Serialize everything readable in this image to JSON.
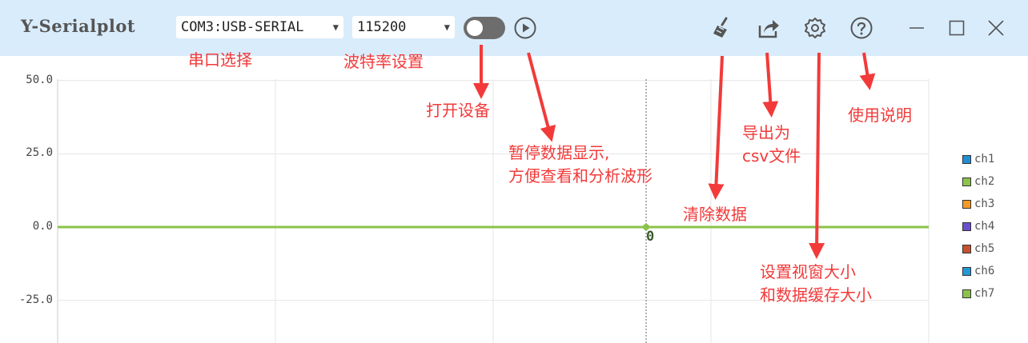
{
  "app": {
    "title": "Y-Serialplot"
  },
  "toolbar": {
    "port": "COM3:USB-SERIAL",
    "baud": "115200",
    "toggle_on": false
  },
  "annotations": {
    "port_select": "串口选择",
    "baud_set": "波特率设置",
    "open_device": "打开设备",
    "pause_line1": "暂停数据显示,",
    "pause_line2": "方便查看和分析波形",
    "clear": "清除数据",
    "export_line1": "导出为",
    "export_line2": "csv文件",
    "settings_line1": "设置视窗大小",
    "settings_line2": "和数据缓存大小",
    "help": "使用说明"
  },
  "chart_data": {
    "type": "line",
    "yticks": [
      "50.0",
      "25.0",
      "0.0",
      "-25.0"
    ],
    "ylim": [
      -40,
      50
    ],
    "grid": true,
    "legend_position": "right",
    "series": [
      {
        "name": "ch1",
        "color": "#1f8ed6"
      },
      {
        "name": "ch2",
        "color": "#8bc34a"
      },
      {
        "name": "ch3",
        "color": "#f59a23"
      },
      {
        "name": "ch4",
        "color": "#6a4fd0"
      },
      {
        "name": "ch5",
        "color": "#c8502e"
      },
      {
        "name": "ch6",
        "color": "#1f9ad6"
      },
      {
        "name": "ch7",
        "color": "#8bc34a"
      }
    ],
    "visible_line": {
      "series": "ch2",
      "value": 0
    },
    "cursor_label": "0"
  },
  "icons": {
    "play": "play-circle-icon",
    "clear": "broom-icon",
    "export": "share-icon",
    "settings": "gear-icon",
    "help": "help-circle-icon",
    "minimize": "minimize-icon",
    "maximize": "maximize-icon",
    "close": "close-icon"
  }
}
